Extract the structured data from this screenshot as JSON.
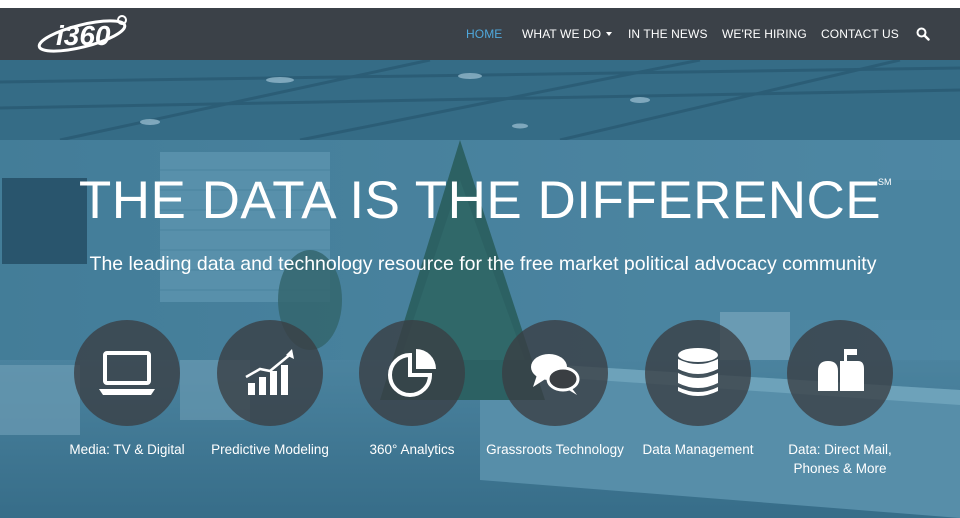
{
  "header": {
    "logo_text": "i360",
    "nav": [
      {
        "label": "HOME",
        "active": true
      },
      {
        "label": "WHAT WE DO",
        "active": false
      },
      {
        "label": "IN THE NEWS",
        "active": false
      },
      {
        "label": "WE'RE HIRING",
        "active": false
      },
      {
        "label": "CONTACT US",
        "active": false
      }
    ],
    "search_icon": "search-icon"
  },
  "hero": {
    "title": "THE DATA IS THE DIFFERENCE",
    "title_mark": "SM",
    "subtitle": "The leading data and technology resource for the free market political advocacy community",
    "overlay_color": "#2f6f93"
  },
  "services": [
    {
      "label": "Media: TV & Digital",
      "icon": "monitor-icon"
    },
    {
      "label": "Predictive Modeling",
      "icon": "bar-chart-icon"
    },
    {
      "label": "360° Analytics",
      "icon": "pie-chart-icon"
    },
    {
      "label": "Grassroots Technology",
      "icon": "chat-bubbles-icon"
    },
    {
      "label": "Data Management",
      "icon": "database-icon"
    },
    {
      "label": "Data: Direct Mail, Phones & More",
      "icon": "mailbox-icon"
    }
  ],
  "colors": {
    "navbar": "#3b4148",
    "active_link": "#4fa8dc",
    "icon_circle": "#3a3e42"
  }
}
